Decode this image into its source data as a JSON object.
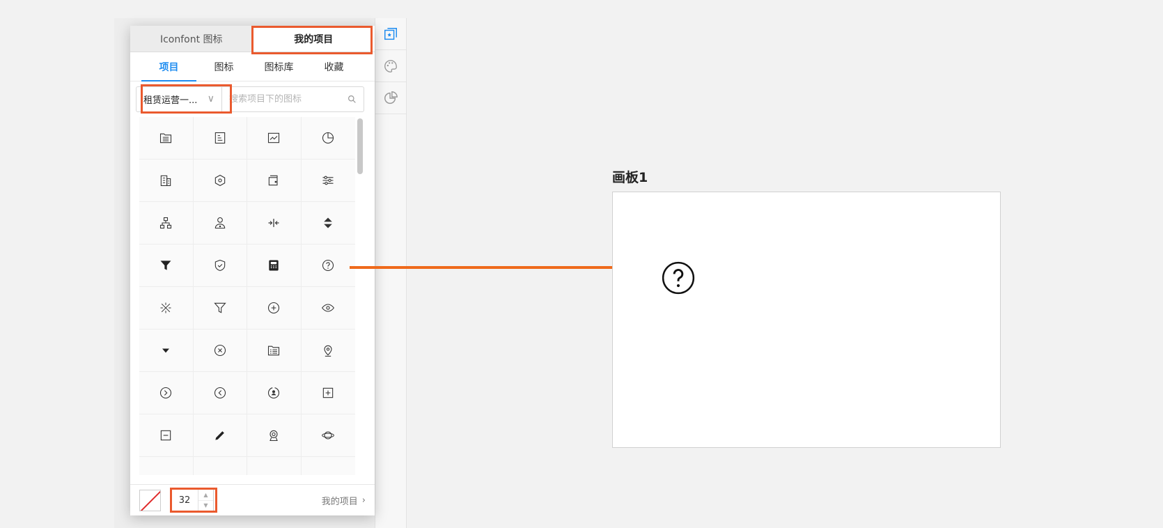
{
  "panel": {
    "top_tabs": [
      {
        "label": "Iconfont 图标",
        "active": false
      },
      {
        "label": "我的项目",
        "active": true
      }
    ],
    "sub_tabs": [
      {
        "label": "项目",
        "active": true
      },
      {
        "label": "图标",
        "active": false
      },
      {
        "label": "图标库",
        "active": false
      },
      {
        "label": "收藏",
        "active": false
      }
    ],
    "project_select": {
      "value": "租赁运营一..."
    },
    "search": {
      "placeholder": "搜索项目下的图标",
      "value": ""
    },
    "icon_grid": [
      "folder-list-icon",
      "document-lines-icon",
      "line-chart-icon",
      "pie-chart-icon",
      "building-grid-icon",
      "hexagon-nut-icon",
      "wallet-icon",
      "sliders-icon",
      "org-chart-icon",
      "user-badge-icon",
      "split-horizontal-icon",
      "sort-up-down-icon",
      "filter-solid-icon",
      "shield-check-icon",
      "calculator-icon",
      "question-circle-icon",
      "sparkle-cross-icon",
      "filter-outline-icon",
      "plus-circle-icon",
      "eye-icon",
      "caret-down-icon",
      "close-circle-icon",
      "file-list-icon",
      "location-pin-icon",
      "chevron-right-circle-icon",
      "chevron-left-circle-icon",
      "user-refresh-icon",
      "plus-square-icon",
      "minus-square-icon",
      "pencil-icon",
      "camera-lens-icon",
      "planet-cloud-icon"
    ],
    "footer": {
      "size_value": "32",
      "my_projects_label": "我的项目",
      "stroke_color": "#e02b2b"
    }
  },
  "artboard": {
    "title": "画板1",
    "placed_icon": "question-circle-icon"
  },
  "colors": {
    "accent": "#1e8cf0",
    "highlight": "#ea5a2e",
    "arrow": "#ef6a1b"
  }
}
